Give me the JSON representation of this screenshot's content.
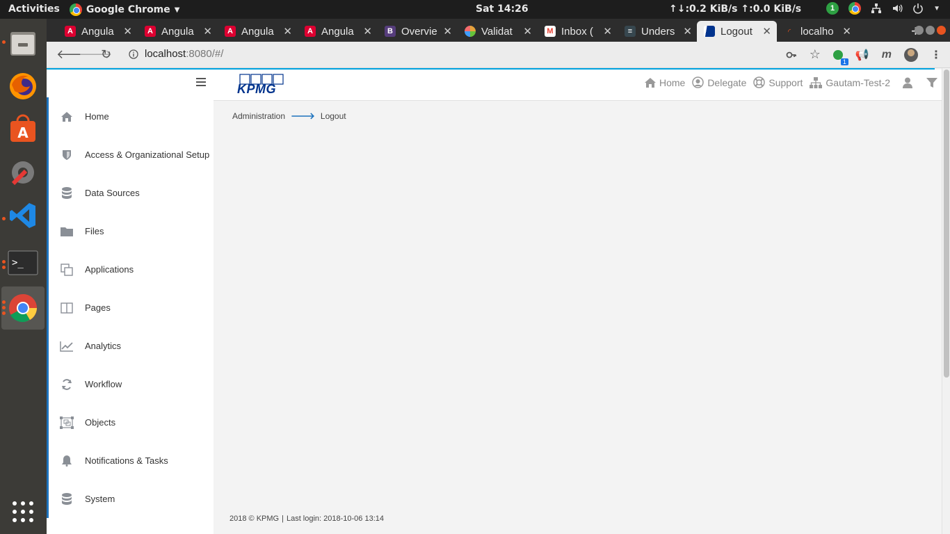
{
  "desktop": {
    "activities": "Activities",
    "app_name": "Google Chrome",
    "clock": "Sat 14:26",
    "network": "↑↓:0.2 KiB/s ↑:0.0 KiB/s",
    "notification_count": "1"
  },
  "browser": {
    "tabs": [
      {
        "title": "Angula",
        "favicon": "angular-icon",
        "color": "#dd0031"
      },
      {
        "title": "Angula",
        "favicon": "angular-icon",
        "color": "#dd0031"
      },
      {
        "title": "Angula",
        "favicon": "angular-icon",
        "color": "#dd0031"
      },
      {
        "title": "Angula",
        "favicon": "angular-icon",
        "color": "#dd0031"
      },
      {
        "title": "Overvie",
        "favicon": "bootstrap-icon",
        "color": "#563d7c"
      },
      {
        "title": "Validat",
        "favicon": "validator-icon",
        "color": "#e6a23c"
      },
      {
        "title": "Inbox (",
        "favicon": "gmail-icon",
        "color": "#ea4335"
      },
      {
        "title": "Unders",
        "favicon": "docs-icon",
        "color": "#37474f"
      },
      {
        "title": "Logout",
        "favicon": "kpmg-icon",
        "color": "#00338d",
        "active": true
      },
      {
        "title": "localho",
        "favicon": "loading-icon",
        "color": "#e95420"
      }
    ],
    "url": {
      "host": "localhost",
      "path": ":8080/#/"
    },
    "extension_badge": "1"
  },
  "app": {
    "brand": "KPMG",
    "header": {
      "home": "Home",
      "delegate": "Delegate",
      "support": "Support",
      "tenant": "Gautam-Test-2"
    },
    "sidebar": {
      "items": [
        {
          "label": "Home",
          "icon": "home-icon"
        },
        {
          "label": "Access & Organizational Setup",
          "icon": "shield-icon"
        },
        {
          "label": "Data Sources",
          "icon": "database-icon"
        },
        {
          "label": "Files",
          "icon": "folder-icon"
        },
        {
          "label": "Applications",
          "icon": "copy-icon"
        },
        {
          "label": "Pages",
          "icon": "columns-icon"
        },
        {
          "label": "Analytics",
          "icon": "line-chart-icon"
        },
        {
          "label": "Workflow",
          "icon": "refresh-icon"
        },
        {
          "label": "Objects",
          "icon": "object-group-icon"
        },
        {
          "label": "Notifications & Tasks",
          "icon": "bell-icon"
        },
        {
          "label": "System",
          "icon": "database-icon"
        }
      ]
    },
    "breadcrumb": {
      "parent": "Administration",
      "current": "Logout"
    },
    "footer": {
      "copyright": "2018 © KPMG",
      "separator": "|",
      "last_login": "Last login: 2018-10-06 13:14"
    }
  },
  "colors": {
    "accent": "#1e73be",
    "brand": "#00338d",
    "topline": "#00a3e0"
  }
}
